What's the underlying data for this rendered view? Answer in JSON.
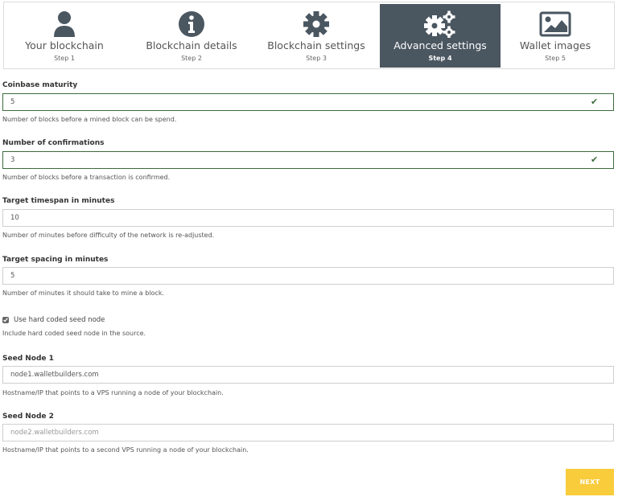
{
  "steps": [
    {
      "title": "Your blockchain",
      "sub": "Step 1",
      "icon": "user-icon",
      "active": false
    },
    {
      "title": "Blockchain details",
      "sub": "Step 2",
      "icon": "info-icon",
      "active": false
    },
    {
      "title": "Blockchain settings",
      "sub": "Step 3",
      "icon": "gear-icon",
      "active": false
    },
    {
      "title": "Advanced settings",
      "sub": "Step 4",
      "icon": "gears-icon",
      "active": true
    },
    {
      "title": "Wallet images",
      "sub": "Step 5",
      "icon": "image-icon",
      "active": false
    }
  ],
  "form": {
    "coinbase_maturity": {
      "label": "Coinbase maturity",
      "value": "5",
      "help": "Number of blocks before a mined block can be spend.",
      "valid": true
    },
    "confirmations": {
      "label": "Number of confirmations",
      "value": "3",
      "help": "Number of blocks before a transaction is confirmed.",
      "valid": true
    },
    "target_timespan": {
      "label": "Target timespan in minutes",
      "value": "10",
      "help": "Number of minutes before difficulty of the network is re-adjusted."
    },
    "target_spacing": {
      "label": "Target spacing in minutes",
      "value": "5",
      "help": "Number of minutes it should take to mine a block."
    },
    "hard_coded_seed": {
      "label": "Use hard coded seed node",
      "checked": true,
      "help": "Include hard coded seed node in the source."
    },
    "seed_node_1": {
      "label": "Seed Node 1",
      "value": "node1.walletbuilders.com",
      "help": "Hostname/IP that points to a VPS running a node of your blockchain."
    },
    "seed_node_2": {
      "label": "Seed Node 2",
      "value": "",
      "placeholder": "node2.walletbuilders.com",
      "help": "Hostname/IP that points to a second VPS running a node of your blockchain."
    }
  },
  "actions": {
    "next_label": "NEXT"
  },
  "colors": {
    "active_step": "#4a5660",
    "valid": "#3c6b3c",
    "next_button": "#f9cc3c"
  }
}
